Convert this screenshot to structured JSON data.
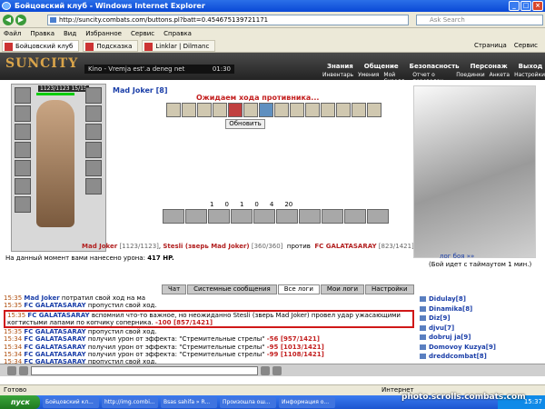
{
  "window": {
    "title": "Бойцовский клуб - Windows Internet Explorer"
  },
  "address": {
    "url": "http://suncity.combats.com/buttons.pl?batt=0.454675139721171",
    "search_placeholder": "Ask Search"
  },
  "menu": [
    "Файл",
    "Правка",
    "Вид",
    "Избранное",
    "Сервис",
    "Справка"
  ],
  "tabs": [
    {
      "label": "Бойцовский клуб",
      "active": true
    },
    {
      "label": "Подсказка"
    },
    {
      "label": "Linklar | Dilmanc"
    }
  ],
  "tools": {
    "page": "Страница",
    "service": "Сервис"
  },
  "game": {
    "logo": "SUNCITY",
    "radio": {
      "text": "Kino - Vremja est'.a deneg net",
      "time": "01:30"
    },
    "top_nav": [
      "Знания",
      "Общение",
      "Безопасность",
      "Персонаж",
      "Выход"
    ],
    "sub_nav": [
      "Инвентарь",
      "Умения",
      "Мой Скролл",
      "Отчет о переводах",
      "Поединки",
      "Анкета",
      "Настройки"
    ],
    "player": {
      "hp": "1123/1123",
      "mana": "15/15",
      "name": "Mad Joker [8]"
    },
    "waiting": "Ожидаем хода противника...",
    "refresh": "Обновить",
    "counters": [
      "1",
      "0",
      "1",
      "0",
      "4",
      "20"
    ],
    "opponents": {
      "me": "Mad Joker",
      "me_hp": "[1123/1123]",
      "pet": "Stesli (зверь Mad Joker)",
      "pet_hp": "[360/360]",
      "vs": "против",
      "enemy": "FC GALATASARAY",
      "enemy_hp": "[823/1421]"
    },
    "damage": {
      "label": "На данный момент вами нанесено урона:",
      "value": "417 HP."
    },
    "fightlog": {
      "link": "лог боя »»",
      "timeout": "(Бой идет с таймаутом 1 мин.)"
    },
    "chat_tabs": [
      "Чат",
      "Системные сообщения",
      "Все логи",
      "Мои логи",
      "Настройки"
    ],
    "chat": [
      {
        "time": "15:35",
        "name": "Mad Joker",
        "text": "потратил свой ход на ма"
      },
      {
        "time": "15:35",
        "name": "FC GALATASARAY",
        "text": "пропустил свой ход."
      },
      {
        "time": "15:35",
        "name": "FC GALATASARAY",
        "text": "вспомнил что-то важное, но неожиданно Stesli (зверь Mad Joker) провел удар ужасающими когтистыми лапами по копчику соперника.",
        "extra": "-100 [857/1421]",
        "highlight": true
      },
      {
        "time": "15:35",
        "name": "FC GALATASARAY",
        "text": "пропустил свой ход."
      },
      {
        "time": "15:34",
        "name": "FC GALATASARAY",
        "text": "получил урон от эффекта: \"Стремительные стрелы\"",
        "extra": "-56 [957/1421]"
      },
      {
        "time": "15:34",
        "name": "FC GALATASARAY",
        "text": "получил урон от эффекта: \"Стремительные стрелы\"",
        "extra": "-95 [1013/1421]"
      },
      {
        "time": "15:34",
        "name": "FC GALATASARAY",
        "text": "получил урон от эффекта: \"Стремительные стрелы\"",
        "extra": "-99 [1108/1421]"
      },
      {
        "time": "15:34",
        "name": "FC GALATASARAY",
        "text": "пропустил свой ход."
      }
    ],
    "users": [
      "Didulay[8]",
      "Dinamika[8]",
      "Diz[9]",
      "djvu[7]",
      "dobruj ja[9]",
      "Domovoy Kuzya[9]",
      "dreddcombat[8]"
    ]
  },
  "status": {
    "left": "Готово",
    "zone": "Интернет"
  },
  "taskbar": {
    "start": "пуск",
    "items": [
      "Бойцовский кл...",
      "http://img.combi...",
      "Bsas sahifa » R...",
      "Произошла ош...",
      "Информация о..."
    ],
    "clock": "15:37"
  },
  "watermark": "photo.scrolls.combats.com"
}
